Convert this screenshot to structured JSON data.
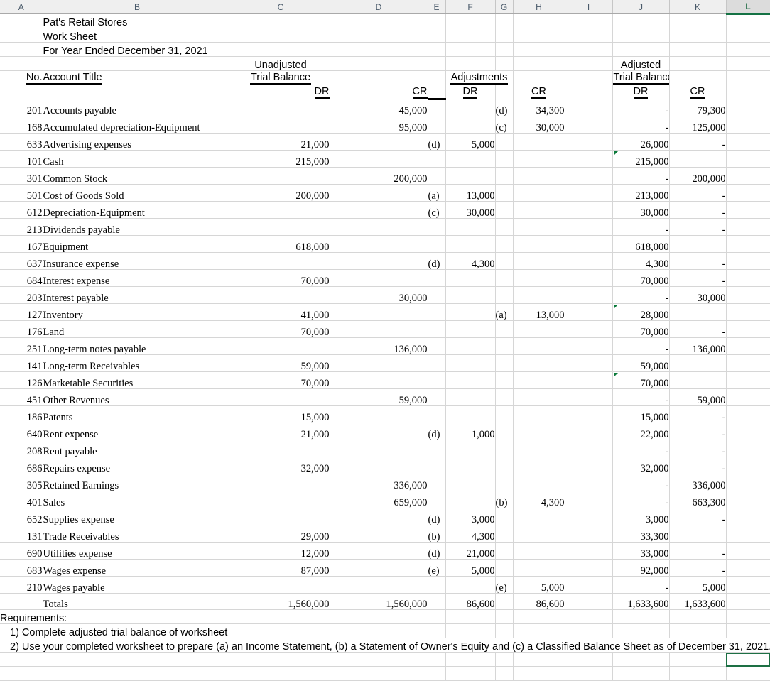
{
  "columns": [
    "A",
    "B",
    "C",
    "D",
    "E",
    "F",
    "G",
    "H",
    "I",
    "J",
    "K",
    "L"
  ],
  "selected_column": "L",
  "title": {
    "line1": "Pat's Retail Stores",
    "line2": "Work Sheet",
    "line3": "For Year Ended December 31, 2021"
  },
  "headers": {
    "no": "No.",
    "account_title": "Account Title",
    "unadjusted": "Unadjusted",
    "trial_balance": "Trial Balance",
    "adjustments": "Adjustments",
    "adjusted": "Adjusted",
    "adj_trial_balance": "Trial Balance",
    "dr": "DR",
    "cr": "CR"
  },
  "rows": [
    {
      "no": "201",
      "account": "Accounts payable",
      "utb_dr": "",
      "utb_cr": "45,000",
      "adj_dr_ref": "",
      "adj_dr": "",
      "adj_cr_ref": "(d)",
      "adj_cr": "34,300",
      "atb_dr": "-",
      "atb_cr": "79,300",
      "tri": false
    },
    {
      "no": "168",
      "account": "Accumulated depreciation-Equipment",
      "utb_dr": "",
      "utb_cr": "95,000",
      "adj_dr_ref": "",
      "adj_dr": "",
      "adj_cr_ref": "(c)",
      "adj_cr": "30,000",
      "atb_dr": "-",
      "atb_cr": "125,000",
      "tri": false
    },
    {
      "no": "633",
      "account": "Advertising expenses",
      "utb_dr": "21,000",
      "utb_cr": "",
      "adj_dr_ref": "(d)",
      "adj_dr": "5,000",
      "adj_cr_ref": "",
      "adj_cr": "",
      "atb_dr": "26,000",
      "atb_cr": "-",
      "tri": false
    },
    {
      "no": "101",
      "account": "Cash",
      "utb_dr": "215,000",
      "utb_cr": "",
      "adj_dr_ref": "",
      "adj_dr": "",
      "adj_cr_ref": "",
      "adj_cr": "",
      "atb_dr": "215,000",
      "atb_cr": "",
      "tri": true
    },
    {
      "no": "301",
      "account": "Common Stock",
      "utb_dr": "",
      "utb_cr": "200,000",
      "adj_dr_ref": "",
      "adj_dr": "",
      "adj_cr_ref": "",
      "adj_cr": "",
      "atb_dr": "-",
      "atb_cr": "200,000",
      "tri": false
    },
    {
      "no": "501",
      "account": "Cost of Goods Sold",
      "utb_dr": "200,000",
      "utb_cr": "",
      "adj_dr_ref": "(a)",
      "adj_dr": "13,000",
      "adj_cr_ref": "",
      "adj_cr": "",
      "atb_dr": "213,000",
      "atb_cr": "-",
      "tri": false
    },
    {
      "no": "612",
      "account": "Depreciation-Equipment",
      "utb_dr": "",
      "utb_cr": "",
      "adj_dr_ref": "(c)",
      "adj_dr": "30,000",
      "adj_cr_ref": "",
      "adj_cr": "",
      "atb_dr": "30,000",
      "atb_cr": "-",
      "tri": false
    },
    {
      "no": "213",
      "account": "Dividends payable",
      "utb_dr": "",
      "utb_cr": "",
      "adj_dr_ref": "",
      "adj_dr": "",
      "adj_cr_ref": "",
      "adj_cr": "",
      "atb_dr": "-",
      "atb_cr": "-",
      "tri": false
    },
    {
      "no": "167",
      "account": "Equipment",
      "utb_dr": "618,000",
      "utb_cr": "",
      "adj_dr_ref": "",
      "adj_dr": "",
      "adj_cr_ref": "",
      "adj_cr": "",
      "atb_dr": "618,000",
      "atb_cr": "",
      "tri": false
    },
    {
      "no": "637",
      "account": "Insurance expense",
      "utb_dr": "",
      "utb_cr": "",
      "adj_dr_ref": "(d)",
      "adj_dr": "4,300",
      "adj_cr_ref": "",
      "adj_cr": "",
      "atb_dr": "4,300",
      "atb_cr": "-",
      "tri": false
    },
    {
      "no": "684",
      "account": "Interest expense",
      "utb_dr": "70,000",
      "utb_cr": "",
      "adj_dr_ref": "",
      "adj_dr": "",
      "adj_cr_ref": "",
      "adj_cr": "",
      "atb_dr": "70,000",
      "atb_cr": "-",
      "tri": false
    },
    {
      "no": "203",
      "account": "Interest payable",
      "utb_dr": "",
      "utb_cr": "30,000",
      "adj_dr_ref": "",
      "adj_dr": "",
      "adj_cr_ref": "",
      "adj_cr": "",
      "atb_dr": "-",
      "atb_cr": "30,000",
      "tri": false
    },
    {
      "no": "127",
      "account": "Inventory",
      "utb_dr": "41,000",
      "utb_cr": "",
      "adj_dr_ref": "",
      "adj_dr": "",
      "adj_cr_ref": "(a)",
      "adj_cr": "13,000",
      "atb_dr": "28,000",
      "atb_cr": "",
      "tri": true
    },
    {
      "no": "176",
      "account": "Land",
      "utb_dr": "70,000",
      "utb_cr": "",
      "adj_dr_ref": "",
      "adj_dr": "",
      "adj_cr_ref": "",
      "adj_cr": "",
      "atb_dr": "70,000",
      "atb_cr": "-",
      "tri": false
    },
    {
      "no": "251",
      "account": "Long-term notes payable",
      "utb_dr": "",
      "utb_cr": "136,000",
      "adj_dr_ref": "",
      "adj_dr": "",
      "adj_cr_ref": "",
      "adj_cr": "",
      "atb_dr": "-",
      "atb_cr": "136,000",
      "tri": false
    },
    {
      "no": "141",
      "account": "Long-term Receivables",
      "utb_dr": "59,000",
      "utb_cr": "",
      "adj_dr_ref": "",
      "adj_dr": "",
      "adj_cr_ref": "",
      "adj_cr": "",
      "atb_dr": "59,000",
      "atb_cr": "",
      "tri": false
    },
    {
      "no": "126",
      "account": "Marketable Securities",
      "utb_dr": "70,000",
      "utb_cr": "",
      "adj_dr_ref": "",
      "adj_dr": "",
      "adj_cr_ref": "",
      "adj_cr": "",
      "atb_dr": "70,000",
      "atb_cr": "",
      "tri": true
    },
    {
      "no": "451",
      "account": "Other Revenues",
      "utb_dr": "",
      "utb_cr": "59,000",
      "adj_dr_ref": "",
      "adj_dr": "",
      "adj_cr_ref": "",
      "adj_cr": "",
      "atb_dr": "-",
      "atb_cr": "59,000",
      "tri": false
    },
    {
      "no": "186",
      "account": "Patents",
      "utb_dr": "15,000",
      "utb_cr": "",
      "adj_dr_ref": "",
      "adj_dr": "",
      "adj_cr_ref": "",
      "adj_cr": "",
      "atb_dr": "15,000",
      "atb_cr": "-",
      "tri": false
    },
    {
      "no": "640",
      "account": "Rent expense",
      "utb_dr": "21,000",
      "utb_cr": "",
      "adj_dr_ref": "(d)",
      "adj_dr": "1,000",
      "adj_cr_ref": "",
      "adj_cr": "",
      "atb_dr": "22,000",
      "atb_cr": "-",
      "tri": false
    },
    {
      "no": "208",
      "account": "Rent payable",
      "utb_dr": "",
      "utb_cr": "",
      "adj_dr_ref": "",
      "adj_dr": "",
      "adj_cr_ref": "",
      "adj_cr": "",
      "atb_dr": "-",
      "atb_cr": "-",
      "tri": false
    },
    {
      "no": "686",
      "account": "Repairs expense",
      "utb_dr": "32,000",
      "utb_cr": "",
      "adj_dr_ref": "",
      "adj_dr": "",
      "adj_cr_ref": "",
      "adj_cr": "",
      "atb_dr": "32,000",
      "atb_cr": "-",
      "tri": false
    },
    {
      "no": "305",
      "account": "Retained Earnings",
      "utb_dr": "",
      "utb_cr": "336,000",
      "adj_dr_ref": "",
      "adj_dr": "",
      "adj_cr_ref": "",
      "adj_cr": "",
      "atb_dr": "-",
      "atb_cr": "336,000",
      "tri": false
    },
    {
      "no": "401",
      "account": "Sales",
      "utb_dr": "",
      "utb_cr": "659,000",
      "adj_dr_ref": "",
      "adj_dr": "",
      "adj_cr_ref": "(b)",
      "adj_cr": "4,300",
      "atb_dr": "-",
      "atb_cr": "663,300",
      "tri": false
    },
    {
      "no": "652",
      "account": "Supplies expense",
      "utb_dr": "",
      "utb_cr": "",
      "adj_dr_ref": "(d)",
      "adj_dr": "3,000",
      "adj_cr_ref": "",
      "adj_cr": "",
      "atb_dr": "3,000",
      "atb_cr": "-",
      "tri": false
    },
    {
      "no": "131",
      "account": "Trade Receivables",
      "utb_dr": "29,000",
      "utb_cr": "",
      "adj_dr_ref": "(b)",
      "adj_dr": "4,300",
      "adj_cr_ref": "",
      "adj_cr": "",
      "atb_dr": "33,300",
      "atb_cr": "",
      "tri": false
    },
    {
      "no": "690",
      "account": "Utilities expense",
      "utb_dr": "12,000",
      "utb_cr": "",
      "adj_dr_ref": "(d)",
      "adj_dr": "21,000",
      "adj_cr_ref": "",
      "adj_cr": "",
      "atb_dr": "33,000",
      "atb_cr": "-",
      "tri": false
    },
    {
      "no": "683",
      "account": "Wages expense",
      "utb_dr": "87,000",
      "utb_cr": "",
      "adj_dr_ref": "(e)",
      "adj_dr": "5,000",
      "adj_cr_ref": "",
      "adj_cr": "",
      "atb_dr": "92,000",
      "atb_cr": "-",
      "tri": false
    },
    {
      "no": "210",
      "account": "Wages payable",
      "utb_dr": "",
      "utb_cr": "",
      "adj_dr_ref": "",
      "adj_dr": "",
      "adj_cr_ref": "(e)",
      "adj_cr": "5,000",
      "atb_dr": "-",
      "atb_cr": "5,000",
      "tri": false
    }
  ],
  "totals": {
    "label": "Totals",
    "utb_dr": "1,560,000",
    "utb_cr": "1,560,000",
    "adj_dr": "86,600",
    "adj_cr": "86,600",
    "atb_dr": "1,633,600",
    "atb_cr": "1,633,600"
  },
  "requirements": {
    "heading": "Requirements:",
    "item1": "1) Complete adjusted trial balance of worksheet",
    "item2": "2) Use your completed worksheet to prepare (a) an Income Statement, (b) a Statement of Owner's Equity and (c) a Classified Balance Sheet as of December 31, 2021."
  },
  "colors": {
    "grid": "#d6d6d6",
    "header_bg": "#efefef",
    "selection": "#147244",
    "comment_marker": "#0b7a3b"
  }
}
